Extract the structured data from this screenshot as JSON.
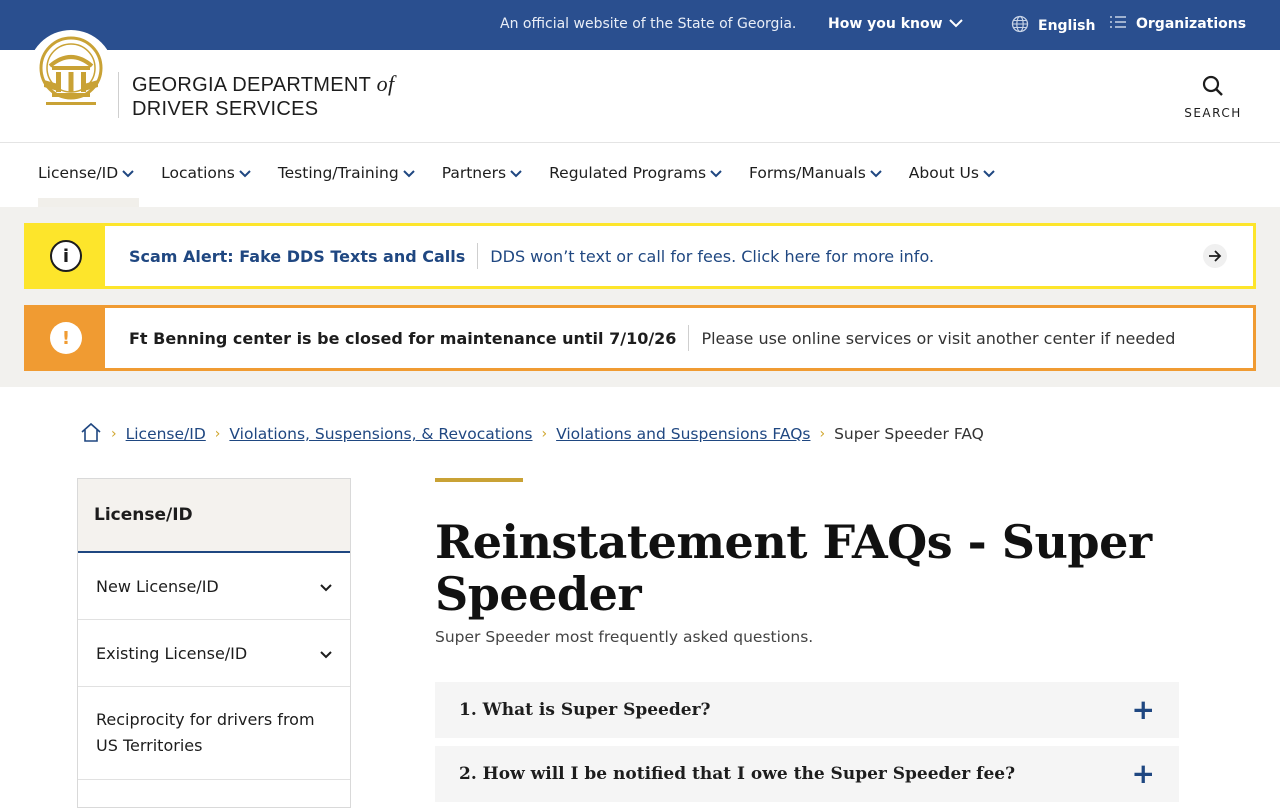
{
  "topbar": {
    "official_text": "An official website of the State of Georgia.",
    "how_you_know": "How you know",
    "language": "English",
    "organizations": "Organizations"
  },
  "header": {
    "brand_line1": "GEORGIA DEPARTMENT",
    "brand_of": "of",
    "brand_line2": "DRIVER SERVICES",
    "search_label": "SEARCH"
  },
  "nav": {
    "items": [
      {
        "label": "License/ID"
      },
      {
        "label": "Locations"
      },
      {
        "label": "Testing/Training"
      },
      {
        "label": "Partners"
      },
      {
        "label": "Regulated Programs"
      },
      {
        "label": "Forms/Manuals"
      },
      {
        "label": "About Us"
      }
    ]
  },
  "alerts": {
    "scam": {
      "icon": "i",
      "title": "Scam Alert: Fake DDS Texts and Calls",
      "message": "DDS won’t text or call for fees. Click here for more info."
    },
    "closure": {
      "icon": "!",
      "title": "Ft Benning center is be closed for maintenance until 7/10/26",
      "message": "Please use online services or visit another center if needed"
    }
  },
  "breadcrumb": {
    "items": [
      "License/ID",
      "Violations, Suspensions, & Revocations",
      "Violations and Suspensions FAQs"
    ],
    "current": "Super Speeder FAQ"
  },
  "sidebar": {
    "heading": "License/ID",
    "items": [
      "New License/ID",
      "Existing License/ID",
      "Reciprocity for drivers from US Territories"
    ]
  },
  "main": {
    "title": "Reinstatement FAQs - Super Speeder",
    "subtitle": "Super Speeder most frequently asked questions.",
    "faqs": [
      "1. What is Super Speeder?",
      "2. How will I be notified that I owe the Super Speeder fee?"
    ]
  },
  "colors": {
    "brand_blue": "#2a4f8f",
    "link_blue": "#1f4781",
    "gold": "#c9a235",
    "alert_yellow": "#fde52b",
    "alert_orange": "#f09b32"
  }
}
